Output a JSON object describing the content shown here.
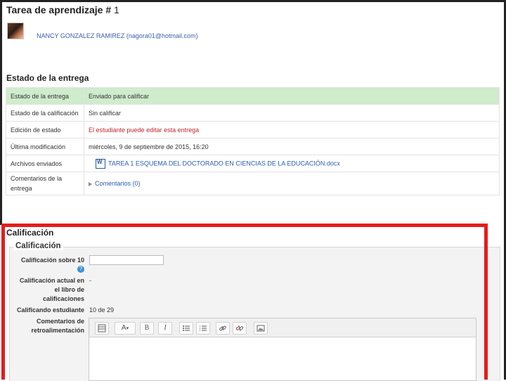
{
  "page": {
    "title_text": "Tarea de aprendizaje #",
    "title_num": "1",
    "user_line": "NANCY GONZALEZ RAMIREZ (nagora01@hotmail.com)"
  },
  "submission_status": {
    "heading": "Estado de la entrega",
    "rows": [
      {
        "label": "Estado de la entrega",
        "value": "Enviado para calificar"
      },
      {
        "label": "Estado de la calificación",
        "value": "Sin calificar"
      },
      {
        "label": "Edición de estado",
        "value": "El estudiante puede editar esta entrega"
      },
      {
        "label": "Última modificación",
        "value": "miércoles, 9 de septiembre de 2015, 16:20"
      },
      {
        "label": "Archivos enviados",
        "value": "TAREA 1 ESQUEMA DEL DOCTORADO EN CIENCIAS DE LA EDUCACIÓN.docx"
      },
      {
        "label": "Comentarios de la entrega",
        "value": "Comentarios (0)"
      }
    ],
    "file_icon_letter": "W"
  },
  "grading": {
    "heading": "Calificación",
    "legend": "Calificación",
    "grade_label": "Calificación sobre 10",
    "grade_value": "",
    "current_grade_label_l1": "Calificación actual en",
    "current_grade_label_l2": "el libro de",
    "current_grade_label_l3": "calificaciones",
    "current_grade_value": "-",
    "grading_student_label": "Calificando estudiante",
    "grading_student_value": "10 de 29",
    "feedback_label_l1": "Comentarios de",
    "feedback_label_l2": "retroalimentación",
    "help_glyph": "?"
  },
  "editor_toolbar": {
    "font_glyph": "A",
    "bold_glyph": "B",
    "italic_glyph": "I"
  },
  "colors": {
    "highlight": "#e51c1c",
    "status_ok_bg": "#cfeccc",
    "link": "#2a5db0",
    "warning_text": "#c0262d"
  }
}
